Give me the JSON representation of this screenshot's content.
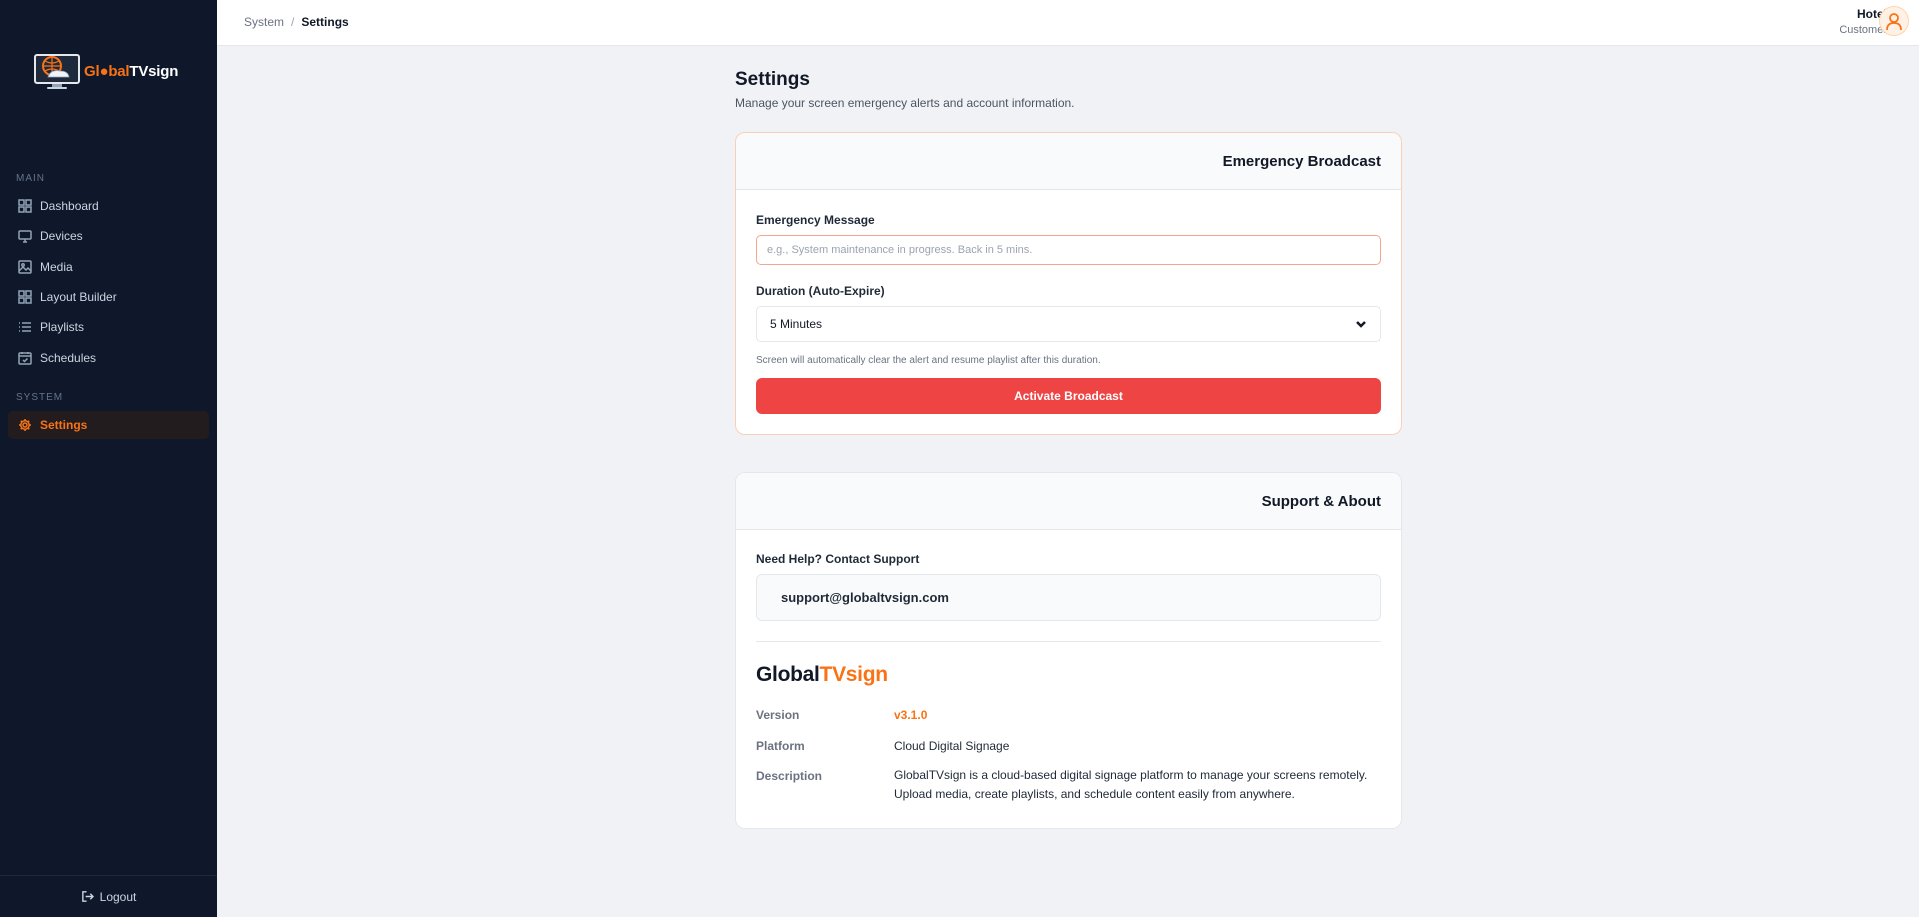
{
  "app": {
    "logo_prefix": "Gl",
    "logo_middle": "bal",
    "logo_suffix": "TVsign"
  },
  "sidebar": {
    "section_main": "MAIN",
    "section_system": "SYSTEM",
    "items": [
      {
        "label": "Dashboard",
        "icon": "grid-icon"
      },
      {
        "label": "Devices",
        "icon": "monitor-icon"
      },
      {
        "label": "Media",
        "icon": "image-icon"
      },
      {
        "label": "Layout Builder",
        "icon": "layout-icon"
      },
      {
        "label": "Playlists",
        "icon": "list-icon"
      },
      {
        "label": "Schedules",
        "icon": "calendar-icon"
      }
    ],
    "settings": {
      "label": "Settings",
      "icon": "gear-icon"
    },
    "logout": "Logout"
  },
  "topbar": {
    "breadcrumb_parent": "System",
    "breadcrumb_sep": "/",
    "breadcrumb_current": "Settings",
    "user_name": "Hotel",
    "user_role": "Customer"
  },
  "page": {
    "title": "Settings",
    "subtitle": "Manage your screen emergency alerts and account information."
  },
  "emergency": {
    "title": "Emergency Broadcast",
    "message_label": "Emergency Message",
    "message_value": "",
    "message_placeholder": "e.g., System maintenance in progress. Back in 5 mins.",
    "duration_label": "Duration (Auto-Expire)",
    "duration_value": "5 Minutes",
    "hint": "Screen will automatically clear the alert and resume playlist after this duration.",
    "button": "Activate Broadcast"
  },
  "support": {
    "title": "Support & About",
    "help_label": "Need Help? Contact Support",
    "email": "support@globaltvsign.com",
    "brand_dark": "Global",
    "brand_orange": "TVsign",
    "version_key": "Version",
    "version_val": "v3.1.0",
    "platform_key": "Platform",
    "platform_val": "Cloud Digital Signage",
    "description_key": "Description",
    "description_val": "GlobalTVsign is a cloud-based digital signage platform to manage your screens remotely. Upload media, create playlists, and schedule content easily from anywhere."
  },
  "colors": {
    "sidebar_bg": "#0f172a",
    "accent": "#f97316",
    "danger": "#ef4444",
    "page_bg": "#f1f2f5"
  }
}
